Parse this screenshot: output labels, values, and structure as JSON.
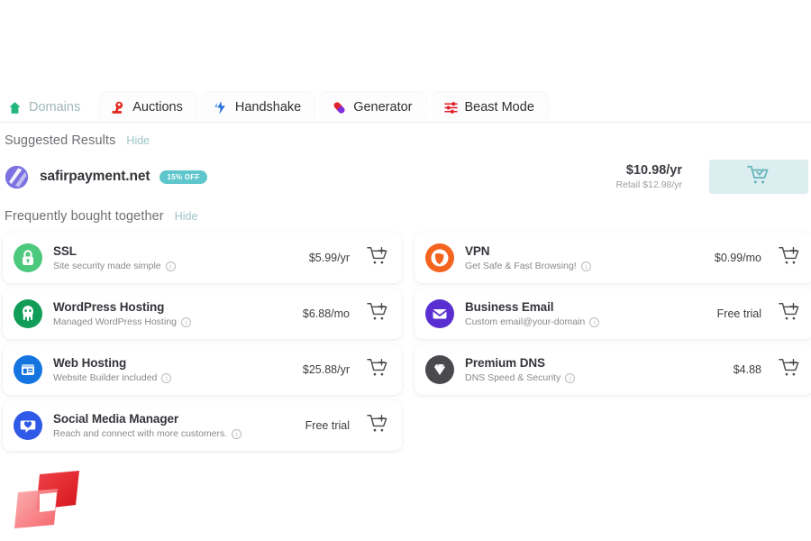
{
  "tabs": [
    {
      "label": "Domains",
      "icon": "house-icon",
      "active": true
    },
    {
      "label": "Auctions",
      "icon": "gavel-icon",
      "active": false
    },
    {
      "label": "Handshake",
      "icon": "handshake-icon",
      "active": false
    },
    {
      "label": "Generator",
      "icon": "capsule-icon",
      "active": false
    },
    {
      "label": "Beast Mode",
      "icon": "sliders-icon",
      "active": false
    }
  ],
  "suggested": {
    "title": "Suggested Results",
    "hide_label": "Hide",
    "domain": "safirpayment.net",
    "badge": "15% OFF",
    "price": "$10.98/yr",
    "retail": "Retail $12.98/yr",
    "cart_state": "added"
  },
  "frequently_bought": {
    "title": "Frequently bought together",
    "hide_label": "Hide"
  },
  "products": [
    {
      "name": "SSL",
      "subtitle": "Site security made simple",
      "price": "$5.99/yr",
      "icon": "lock-icon",
      "color": "#4cc97d",
      "column": "left"
    },
    {
      "name": "VPN",
      "subtitle": "Get Safe & Fast Browsing!",
      "price": "$0.99/mo",
      "icon": "vpn-shield-icon",
      "color": "#f4641e",
      "column": "right"
    },
    {
      "name": "WordPress Hosting",
      "subtitle": "Managed WordPress Hosting",
      "price": "$6.88/mo",
      "icon": "wordpress-icon",
      "color": "#0f9d58",
      "column": "left"
    },
    {
      "name": "Business Email",
      "subtitle": "Custom email@your-domain",
      "price": "Free trial",
      "icon": "envelope-icon",
      "color": "#5a2fd1",
      "column": "right"
    },
    {
      "name": "Web Hosting",
      "subtitle": "Website Builder included",
      "price": "$25.88/yr",
      "icon": "browser-window-icon",
      "color": "#1575e0",
      "column": "left"
    },
    {
      "name": "Premium DNS",
      "subtitle": "DNS Speed & Security",
      "price": "$4.88",
      "icon": "diamond-icon",
      "color": "#4a4a4e",
      "column": "right"
    },
    {
      "name": "Social Media Manager",
      "subtitle": "Reach and connect with more customers.",
      "price": "Free trial",
      "icon": "heart-bubble-icon",
      "color": "#2f5ae8",
      "column": "left"
    }
  ],
  "colors": {
    "badge_teal": "#5ec6cc",
    "cart_added_bg": "#ddeef0",
    "cart_added_fg": "#6bb6bc",
    "hide_link": "#9fc4c7",
    "active_tab_text": "#9fb8b6",
    "brand_red": "#e8262b"
  },
  "info_glyph": "i"
}
